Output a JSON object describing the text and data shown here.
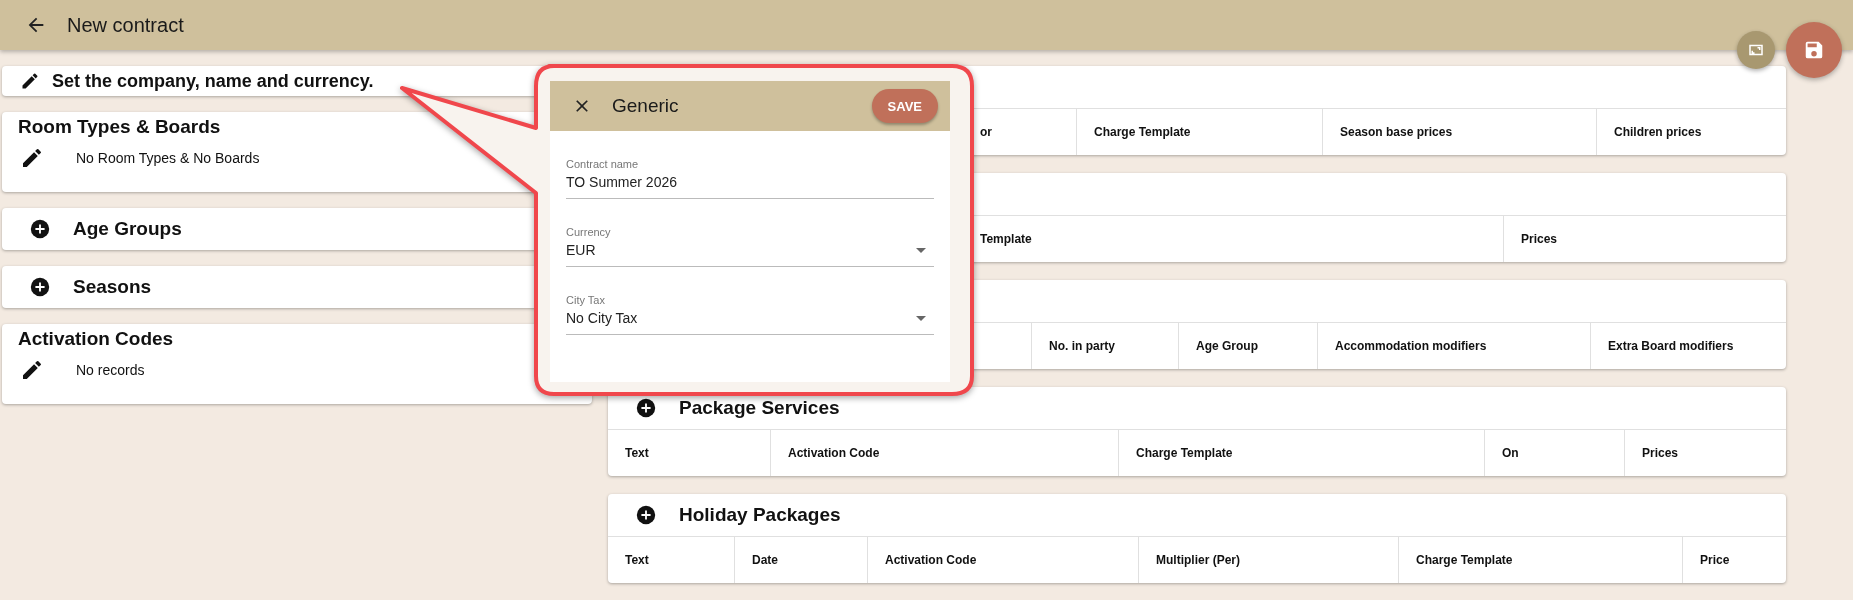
{
  "header": {
    "title": "New contract"
  },
  "summary": {
    "text": "Set the company, name and currency."
  },
  "left_sections": [
    {
      "kind": "list",
      "title": "Room Types & Boards",
      "text": "No Room Types & No Boards"
    },
    {
      "kind": "add",
      "title": "Age Groups"
    },
    {
      "kind": "add",
      "title": "Seasons"
    },
    {
      "kind": "list",
      "title": "Activation Codes",
      "text": "No records"
    }
  ],
  "right_tables": [
    {
      "columns": [
        "or",
        "Charge Template",
        "Season base prices",
        "Children prices"
      ]
    },
    {
      "columns": [
        "Template",
        "Prices"
      ]
    },
    {
      "columns": [
        "No. in party",
        "Age Group",
        "Accommodation modifiers",
        "Extra Board modifiers"
      ]
    },
    {
      "title": "Package Services",
      "columns": [
        "Text",
        "Activation Code",
        "Charge Template",
        "On",
        "Prices"
      ]
    },
    {
      "title": "Holiday Packages",
      "columns": [
        "Text",
        "Date",
        "Activation Code",
        "Multiplier (Per)",
        "Charge Template",
        "Price"
      ]
    }
  ],
  "dialog": {
    "title": "Generic",
    "save": "SAVE",
    "fields": [
      {
        "kind": "text",
        "label": "Contract name",
        "value": "TO Summer 2026"
      },
      {
        "kind": "select",
        "label": "Currency",
        "value": "EUR"
      },
      {
        "kind": "select",
        "label": "City Tax",
        "value": "No City Tax"
      }
    ]
  }
}
